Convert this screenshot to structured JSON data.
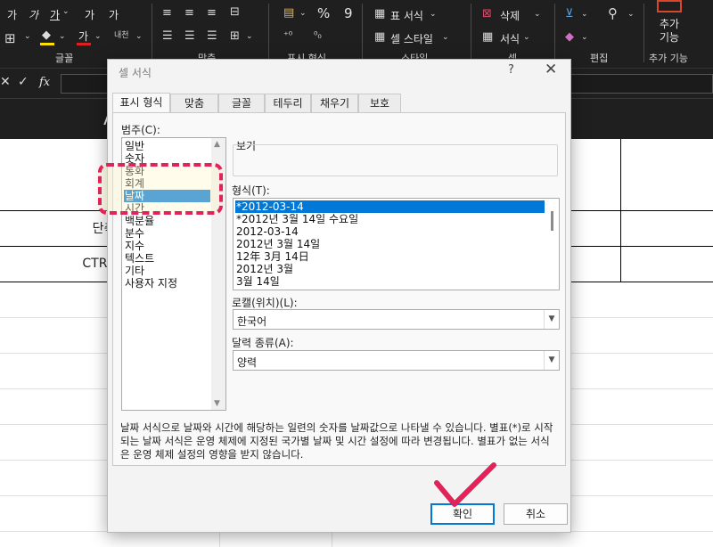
{
  "ribbon": {
    "font_row1": [
      "가",
      "가",
      "가",
      "가",
      "가"
    ],
    "font_color_label": "가",
    "phonetic_label": "내천",
    "group_font": "글꼴",
    "group_align": "맞춤",
    "group_number": "표시 형식",
    "group_styles": "스타일",
    "group_cells": "셀",
    "group_edit": "편집",
    "group_addins": "추가 기능",
    "percent": "%",
    "comma": "9",
    "format_as_table": "표 서식",
    "cell_styles": "셀 스타일",
    "delete": "삭제",
    "format": "서식",
    "addins_btn_line1": "추가",
    "addins_btn_line2": "기능"
  },
  "formula_bar": {
    "fx": "fx"
  },
  "sheet": {
    "column_a": "A",
    "cell_shortcut": "단축키",
    "cell_ctrl": "CTRL + ;"
  },
  "dialog": {
    "title": "셀 서식",
    "help": "?",
    "close": "✕",
    "tabs": [
      "표시 형식",
      "맞춤",
      "글꼴",
      "테두리",
      "채우기",
      "보호"
    ],
    "category_label": "범주(C):",
    "categories": [
      "일반",
      "숫자",
      "통화",
      "회계",
      "날짜",
      "시간",
      "백분율",
      "분수",
      "지수",
      "텍스트",
      "기타",
      "사용자 지정"
    ],
    "selected_category": "날짜",
    "sample_label": "보기",
    "type_label": "형식(T):",
    "types": [
      "*2012-03-14",
      "*2012년 3월 14일 수요일",
      "2012-03-14",
      "2012년 3월 14일",
      "12年 3月 14日",
      "2012년 3월",
      "3월 14일"
    ],
    "locale_label": "로캘(위치)(L):",
    "locale_value": "한국어",
    "calendar_label": "달력 종류(A):",
    "calendar_value": "양력",
    "description": "날짜 서식으로 날짜와 시간에 해당하는 일련의 숫자를 날짜값으로 나타낼 수 있습니다. 별표(*)로 시작되는 날짜 서식은 운영 체제에 지정된 국가별 날짜 및 시간 설정에 따라 변경됩니다. 별표가 없는 서식은 운영 체제 설정의 영향을 받지 않습니다.",
    "ok": "확인",
    "cancel": "취소"
  },
  "colors": {
    "accent": "#0078d7",
    "annotation": "#e0235a"
  }
}
